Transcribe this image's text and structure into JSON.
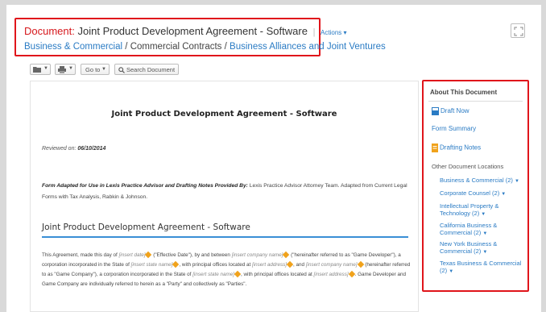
{
  "header": {
    "title_label": "Document:",
    "title": "Joint Product Development Agreement - Software",
    "actions": "Actions ▾",
    "breadcrumb": [
      {
        "label": "Business & Commercial",
        "link": true
      },
      {
        "label": "Commercial Contracts",
        "link": false
      },
      {
        "label": "Business Alliances and Joint Ventures",
        "link": true
      }
    ],
    "breadcrumb_sep": "/"
  },
  "toolbar": {
    "goto_label": "Go to",
    "search_label": "Search Document",
    "caret": "▼"
  },
  "document": {
    "title": "Joint Product Development Agreement - Software",
    "reviewed_label": "Reviewed on:",
    "reviewed_date": "06/10/2014",
    "adapted_bold": "Form Adapted for Use in Lexis Practice Advisor and Drafting Notes Provided By:",
    "adapted_text": " Lexis Practice Advisor Attorney Team. Adapted from Current Legal Forms with Tax Analysis, Rabkin & Johnson.",
    "section_heading": "Joint Product Development Agreement - Software",
    "body": {
      "p1": "This Agreement, made this day of",
      "ph_date": "[insert date]",
      "p2": "(\"Effective Date\"), by and between",
      "ph_company1": "[insert company name]",
      "p3": "(\"hereinafter referred to as \"Game Developer\"), a corporation incorporated in the State of",
      "ph_state1": "[insert state name]",
      "p4": ", with principal offices located at",
      "ph_address1": "[insert address]",
      "p5": ", and",
      "ph_company2": "[insert company name]",
      "p6": "(hereinafter referred to as \"Game Company\"), a corporation incorporated in the State of",
      "ph_state2": "[insert state name]",
      "p7": ", with principal offices located at",
      "ph_address2": "[insert address]",
      "p8": ". Game Developer and Game Company are individually referred to herein as a \"Party\" and collectively as \"Parties\"."
    }
  },
  "about": {
    "title": "About This Document",
    "draft_now": "Draft Now",
    "form_summary": "Form Summary",
    "drafting_notes": "Drafting Notes",
    "other_label": "Other Document Locations",
    "locations": [
      "Business & Commercial (2)",
      "Corporate Counsel (2)",
      "Intellectual Property & Technology (2)",
      "California Business & Commercial (2)",
      "New York Business & Commercial (2)",
      "Texas Business & Commercial (2)"
    ],
    "caret": "▼"
  },
  "colors": {
    "highlight_border": "#e0151b",
    "link": "#2a7bc4",
    "section_rule": "#3a8fd6"
  }
}
